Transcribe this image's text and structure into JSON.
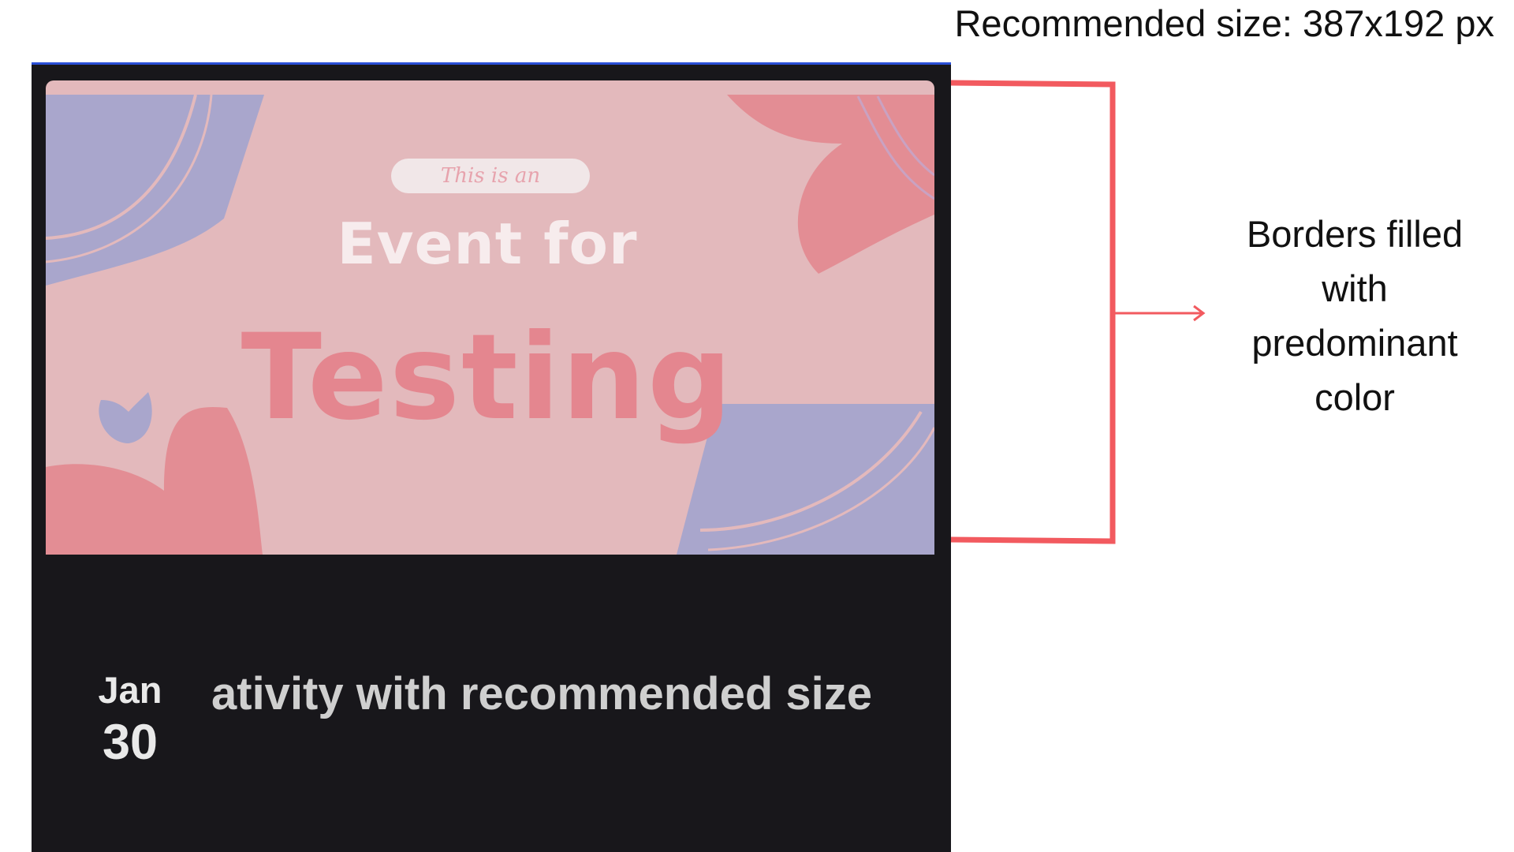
{
  "annotation": {
    "recommended_size": "Recommended size: 387x192 px",
    "borders_note": "Borders filled with predominant color",
    "bracket_color": "#f25a5f"
  },
  "banner": {
    "pill_text": "This is an",
    "line1": "Event for",
    "line2": "Testing",
    "background_color": "#e3b9bc",
    "accent_pink": "#e38d94",
    "accent_lavender": "#a9a6cc"
  },
  "card": {
    "background_color": "#18171b",
    "date_month": "Jan",
    "date_day": "30",
    "title": "ativity with recommended size"
  }
}
